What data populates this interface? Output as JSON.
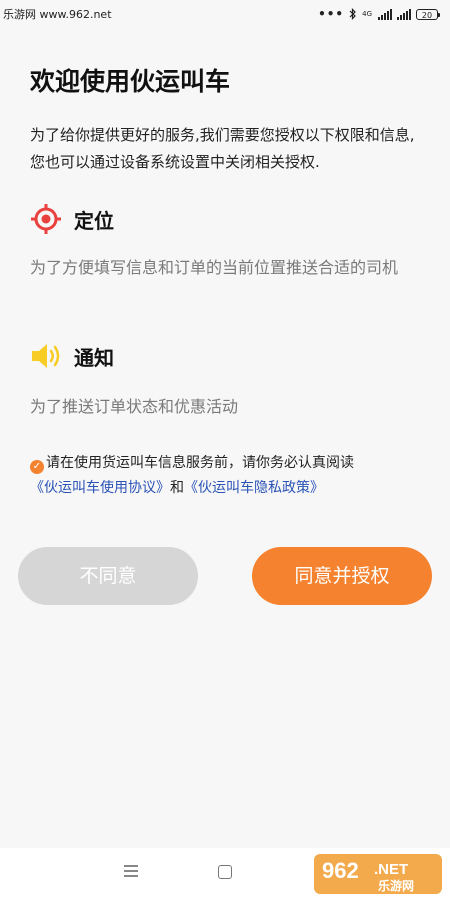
{
  "status_bar": {
    "watermark": "乐游网 www.962.net",
    "dots": "•••",
    "network": "4G",
    "battery": "20"
  },
  "page": {
    "title": "欢迎使用伙运叫车",
    "intro": "为了给你提供更好的服务,我们需要您授权以下权限和信息,您也可以通过设备系统设置中关闭相关授权."
  },
  "permissions": {
    "location": {
      "title": "定位",
      "description": "为了方便填写信息和订单的当前位置推送合适的司机",
      "icon": "location-target-icon"
    },
    "notification": {
      "title": "通知",
      "description": "为了推送订单状态和优惠活动",
      "icon": "speaker-icon"
    }
  },
  "agreement": {
    "text_before": "请在使用货运叫车信息服务前，请你务必认真阅读",
    "user_agreement_link": "《伙运叫车使用协议》",
    "conjunction": "和",
    "privacy_policy_link": "《伙运叫车隐私政策》"
  },
  "buttons": {
    "disagree": "不同意",
    "agree": "同意并授权"
  },
  "logo": {
    "number": "962",
    "domain": ".NET",
    "brand": "乐游网"
  },
  "colors": {
    "accent": "#f5822e",
    "link": "#2b53b6",
    "location_icon": "#e9413d",
    "notification_icon": "#f7cc24",
    "disabled_button": "#d6d6d6"
  }
}
